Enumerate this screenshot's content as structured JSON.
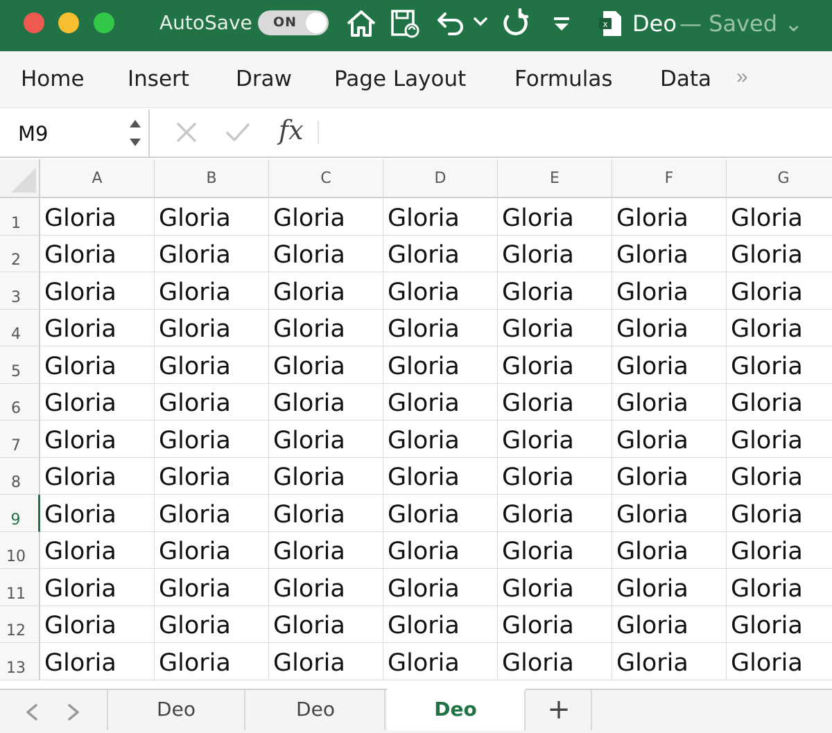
{
  "titlebar": {
    "autosave_label": "AutoSave",
    "autosave_state": "ON",
    "document_name": "Deo",
    "save_status": "— Saved ⌄",
    "icons": [
      "home-icon",
      "save-sync-icon",
      "undo-icon",
      "undo-dropdown-icon",
      "redo-icon",
      "customize-toolbar-icon",
      "excel-file-icon"
    ],
    "colors": {
      "background": "#217346",
      "close": "#ee5a52",
      "minimize": "#f6be30",
      "zoom": "#33c748"
    }
  },
  "ribbon": {
    "tabs": [
      "Home",
      "Insert",
      "Draw",
      "Page Layout",
      "Formulas",
      "Data"
    ],
    "more": "»"
  },
  "formula_bar": {
    "name_box": "M9",
    "fx_label": "fx",
    "formula_value": ""
  },
  "grid": {
    "columns": [
      "A",
      "B",
      "C",
      "D",
      "E",
      "F",
      "G"
    ],
    "rows": [
      "1",
      "2",
      "3",
      "4",
      "5",
      "6",
      "7",
      "8",
      "9",
      "10",
      "11",
      "12",
      "13"
    ],
    "active_row": "9",
    "cells": [
      [
        "Gloria",
        "Gloria",
        "Gloria",
        "Gloria",
        "Gloria",
        "Gloria",
        "Gloria"
      ],
      [
        "Gloria",
        "Gloria",
        "Gloria",
        "Gloria",
        "Gloria",
        "Gloria",
        "Gloria"
      ],
      [
        "Gloria",
        "Gloria",
        "Gloria",
        "Gloria",
        "Gloria",
        "Gloria",
        "Gloria"
      ],
      [
        "Gloria",
        "Gloria",
        "Gloria",
        "Gloria",
        "Gloria",
        "Gloria",
        "Gloria"
      ],
      [
        "Gloria",
        "Gloria",
        "Gloria",
        "Gloria",
        "Gloria",
        "Gloria",
        "Gloria"
      ],
      [
        "Gloria",
        "Gloria",
        "Gloria",
        "Gloria",
        "Gloria",
        "Gloria",
        "Gloria"
      ],
      [
        "Gloria",
        "Gloria",
        "Gloria",
        "Gloria",
        "Gloria",
        "Gloria",
        "Gloria"
      ],
      [
        "Gloria",
        "Gloria",
        "Gloria",
        "Gloria",
        "Gloria",
        "Gloria",
        "Gloria"
      ],
      [
        "Gloria",
        "Gloria",
        "Gloria",
        "Gloria",
        "Gloria",
        "Gloria",
        "Gloria"
      ],
      [
        "Gloria",
        "Gloria",
        "Gloria",
        "Gloria",
        "Gloria",
        "Gloria",
        "Gloria"
      ],
      [
        "Gloria",
        "Gloria",
        "Gloria",
        "Gloria",
        "Gloria",
        "Gloria",
        "Gloria"
      ],
      [
        "Gloria",
        "Gloria",
        "Gloria",
        "Gloria",
        "Gloria",
        "Gloria",
        "Gloria"
      ],
      [
        "Gloria",
        "Gloria",
        "Gloria",
        "Gloria",
        "Gloria",
        "Gloria",
        "Gloria"
      ]
    ]
  },
  "sheets": {
    "tabs": [
      "Deo",
      "Deo",
      "Deo"
    ],
    "active_index": 2,
    "add_label": "+",
    "accent": "#217346"
  }
}
